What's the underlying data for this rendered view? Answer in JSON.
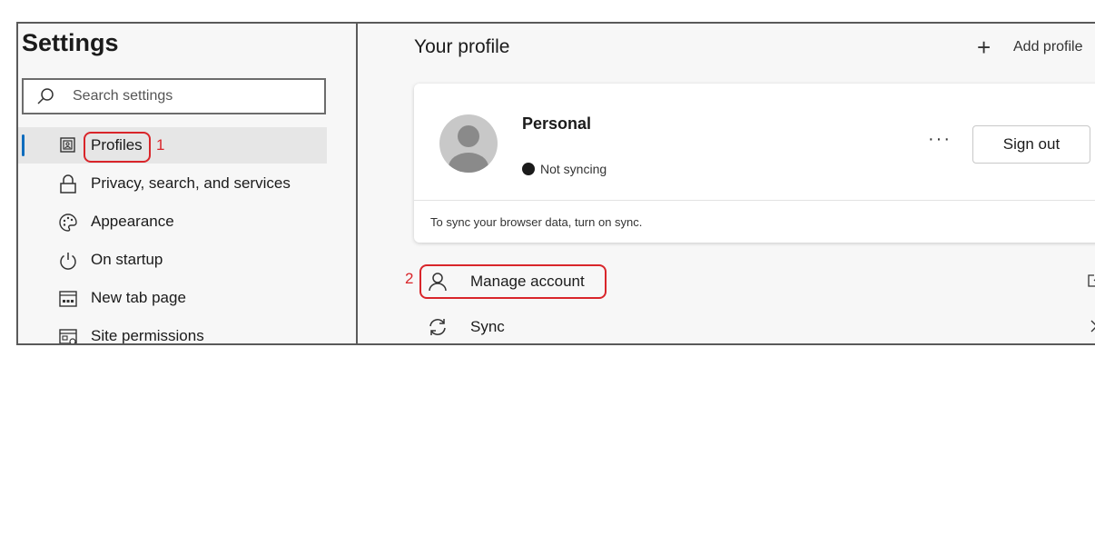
{
  "sidebar": {
    "title": "Settings",
    "search_placeholder": "Search settings",
    "items": [
      {
        "label": "Profiles",
        "icon": "profile-card-icon",
        "active": true
      },
      {
        "label": "Privacy, search, and services",
        "icon": "lock-icon"
      },
      {
        "label": "Appearance",
        "icon": "palette-icon"
      },
      {
        "label": "On startup",
        "icon": "power-icon"
      },
      {
        "label": "New tab page",
        "icon": "new-tab-icon"
      },
      {
        "label": "Site permissions",
        "icon": "site-permissions-icon"
      }
    ]
  },
  "main": {
    "title": "Your profile",
    "add_profile_label": "Add profile",
    "profile_card": {
      "name": "Personal",
      "sync_status": "Not syncing",
      "more_label": "···",
      "sign_out_label": "Sign out",
      "sync_hint": "To sync your browser data, turn on sync."
    },
    "rows": [
      {
        "label": "Manage account",
        "icon": "person-icon",
        "end_icon": "external-link-icon"
      },
      {
        "label": "Sync",
        "icon": "sync-icon",
        "end_icon": "chevron-right-icon"
      }
    ]
  },
  "annotations": {
    "first": "1",
    "second": "2"
  },
  "colors": {
    "accent": "#0f6cbd",
    "annotation": "#d9252a",
    "panel_bg": "#f7f7f7"
  }
}
